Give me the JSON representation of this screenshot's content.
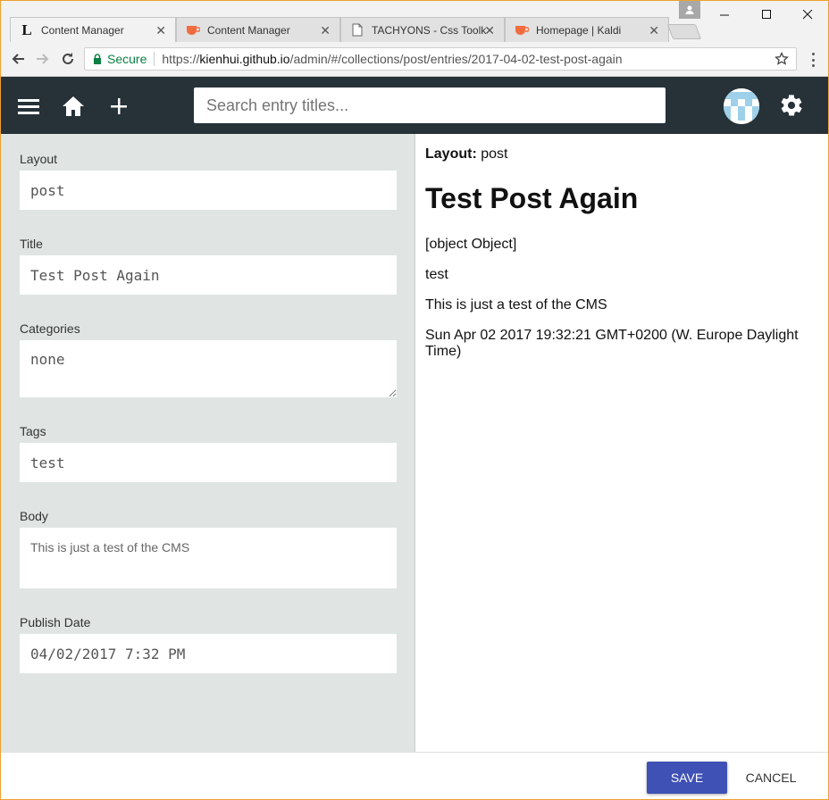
{
  "browser": {
    "tabs": [
      {
        "title": "Content Manager",
        "favicon": "l-letter-icon",
        "active": true
      },
      {
        "title": "Content Manager",
        "favicon": "coffee-cup-icon",
        "active": false
      },
      {
        "title": "TACHYONS - Css Toolk",
        "favicon": "page-icon",
        "active": false
      },
      {
        "title": "Homepage | Kaldi",
        "favicon": "coffee-cup-icon",
        "active": false
      }
    ],
    "secure_label": "Secure",
    "url_prefix": "https://",
    "url_host": "kienhui.github.io",
    "url_path": "/admin/#/collections/post/entries/2017-04-02-test-post-again"
  },
  "app": {
    "search_placeholder": "Search entry titles...",
    "accent": "#3f51b5",
    "header_bg": "#263238"
  },
  "editor": {
    "fields": [
      {
        "label": "Layout",
        "value": "post"
      },
      {
        "label": "Title",
        "value": "Test Post Again"
      },
      {
        "label": "Categories",
        "value": "none"
      },
      {
        "label": "Tags",
        "value": "test"
      },
      {
        "label": "Body",
        "value": "This is just a test of the CMS"
      },
      {
        "label": "Publish Date",
        "value": "04/02/2017 7:32 PM"
      }
    ]
  },
  "preview": {
    "layout_label": "Layout:",
    "layout_value": "post",
    "title": "Test Post Again",
    "categories": "[object Object]",
    "tags": "test",
    "body": "This is just a test of the CMS",
    "date": "Sun Apr 02 2017 19:32:21 GMT+0200 (W. Europe Daylight Time)"
  },
  "actions": {
    "save_label": "SAVE",
    "cancel_label": "CANCEL"
  }
}
